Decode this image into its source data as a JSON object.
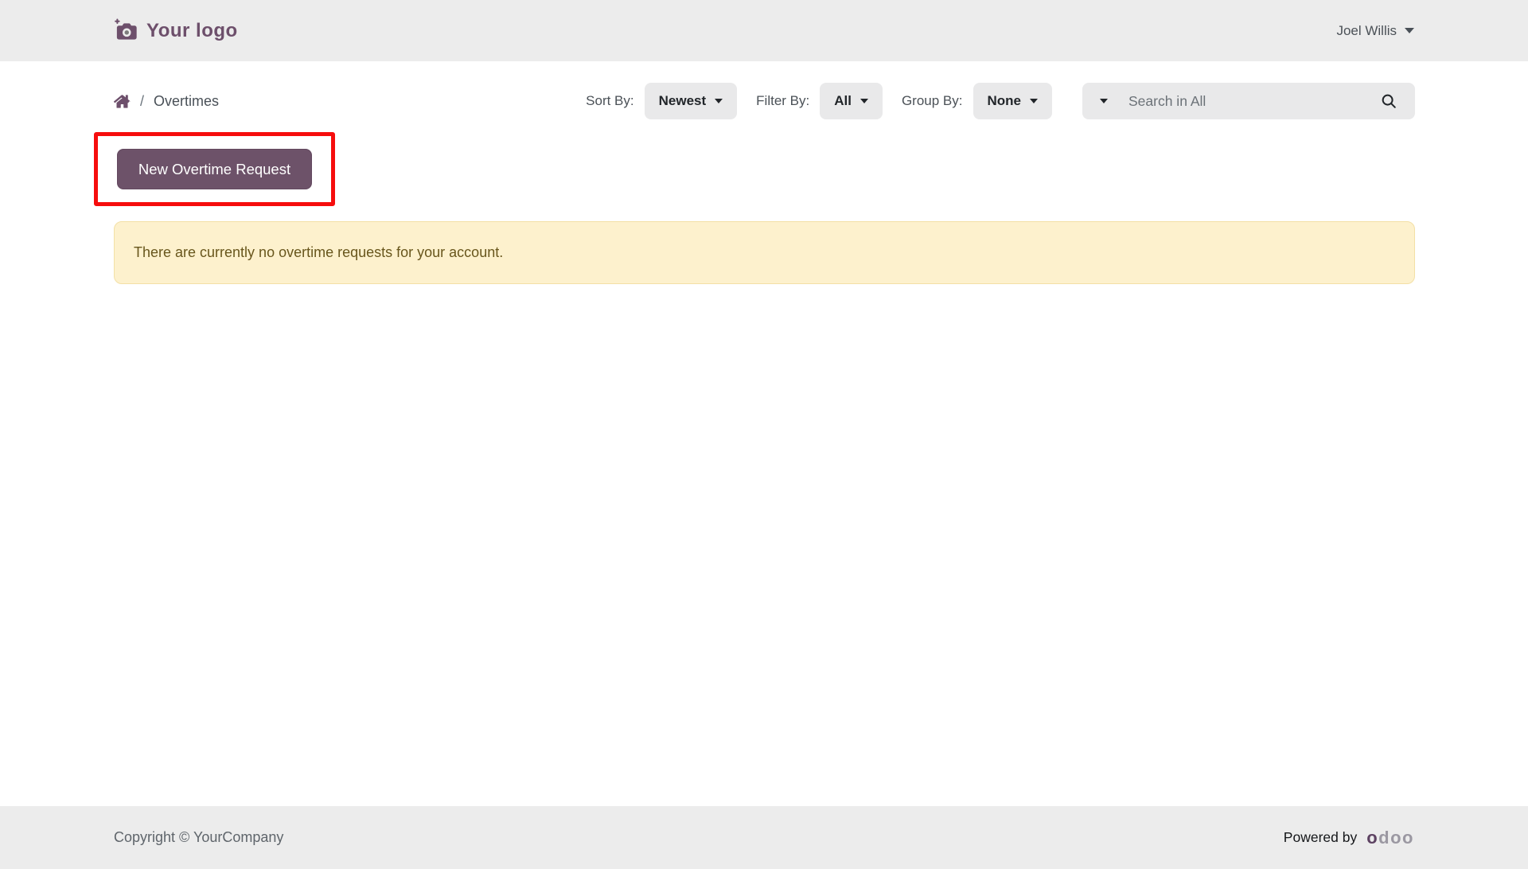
{
  "header": {
    "logo_text": "Your logo",
    "user_name": "Joel Willis"
  },
  "toolbar": {
    "breadcrumb": {
      "separator": "/",
      "current": "Overtimes"
    },
    "sort": {
      "label": "Sort By:",
      "value": "Newest"
    },
    "filter": {
      "label": "Filter By:",
      "value": "All"
    },
    "group": {
      "label": "Group By:",
      "value": "None"
    },
    "search": {
      "placeholder": "Search in All"
    }
  },
  "content": {
    "new_request_button": "New Overtime Request",
    "empty_message": "There are currently no overtime requests for your account."
  },
  "footer": {
    "copyright": "Copyright © YourCompany",
    "powered_by": "Powered by",
    "brand_first": "o",
    "brand_rest": "doo"
  },
  "colors": {
    "accent_purple": "#6d5269",
    "logo_purple": "#6d4f6b",
    "highlight_red": "#f60d0d",
    "alert_bg": "#fdf1cd",
    "alert_border": "#f3e0a6",
    "alert_text": "#68561c",
    "bar_bg": "#ececec",
    "control_bg": "#e9e9ea"
  }
}
